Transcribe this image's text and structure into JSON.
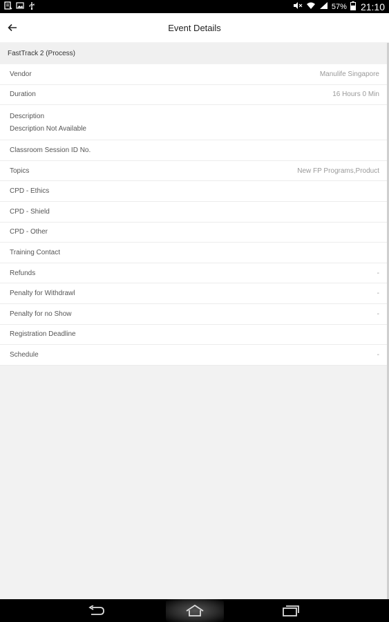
{
  "status_bar": {
    "battery_percent": "57%",
    "time": "21:10"
  },
  "app_bar": {
    "title": "Event Details"
  },
  "event": {
    "name": "FastTrack 2 (Process)"
  },
  "fields": [
    {
      "label": "Vendor",
      "value": "Manulife Singapore"
    },
    {
      "label": "Duration",
      "value": "16 Hours 0 Min"
    },
    {
      "label": "Description",
      "value": "Description Not Available"
    },
    {
      "label": "Classroom Session ID No.",
      "value": ""
    },
    {
      "label": "Topics",
      "value": "New FP Programs,Product"
    },
    {
      "label": "CPD - Ethics",
      "value": ""
    },
    {
      "label": "CPD - Shield",
      "value": ""
    },
    {
      "label": "CPD - Other",
      "value": ""
    },
    {
      "label": "Training Contact",
      "value": ""
    },
    {
      "label": "Refunds",
      "value": "-"
    },
    {
      "label": "Penalty for Withdrawl",
      "value": "-"
    },
    {
      "label": "Penalty for no Show",
      "value": "-"
    },
    {
      "label": "Registration Deadline",
      "value": ""
    },
    {
      "label": "Schedule",
      "value": "-"
    }
  ]
}
